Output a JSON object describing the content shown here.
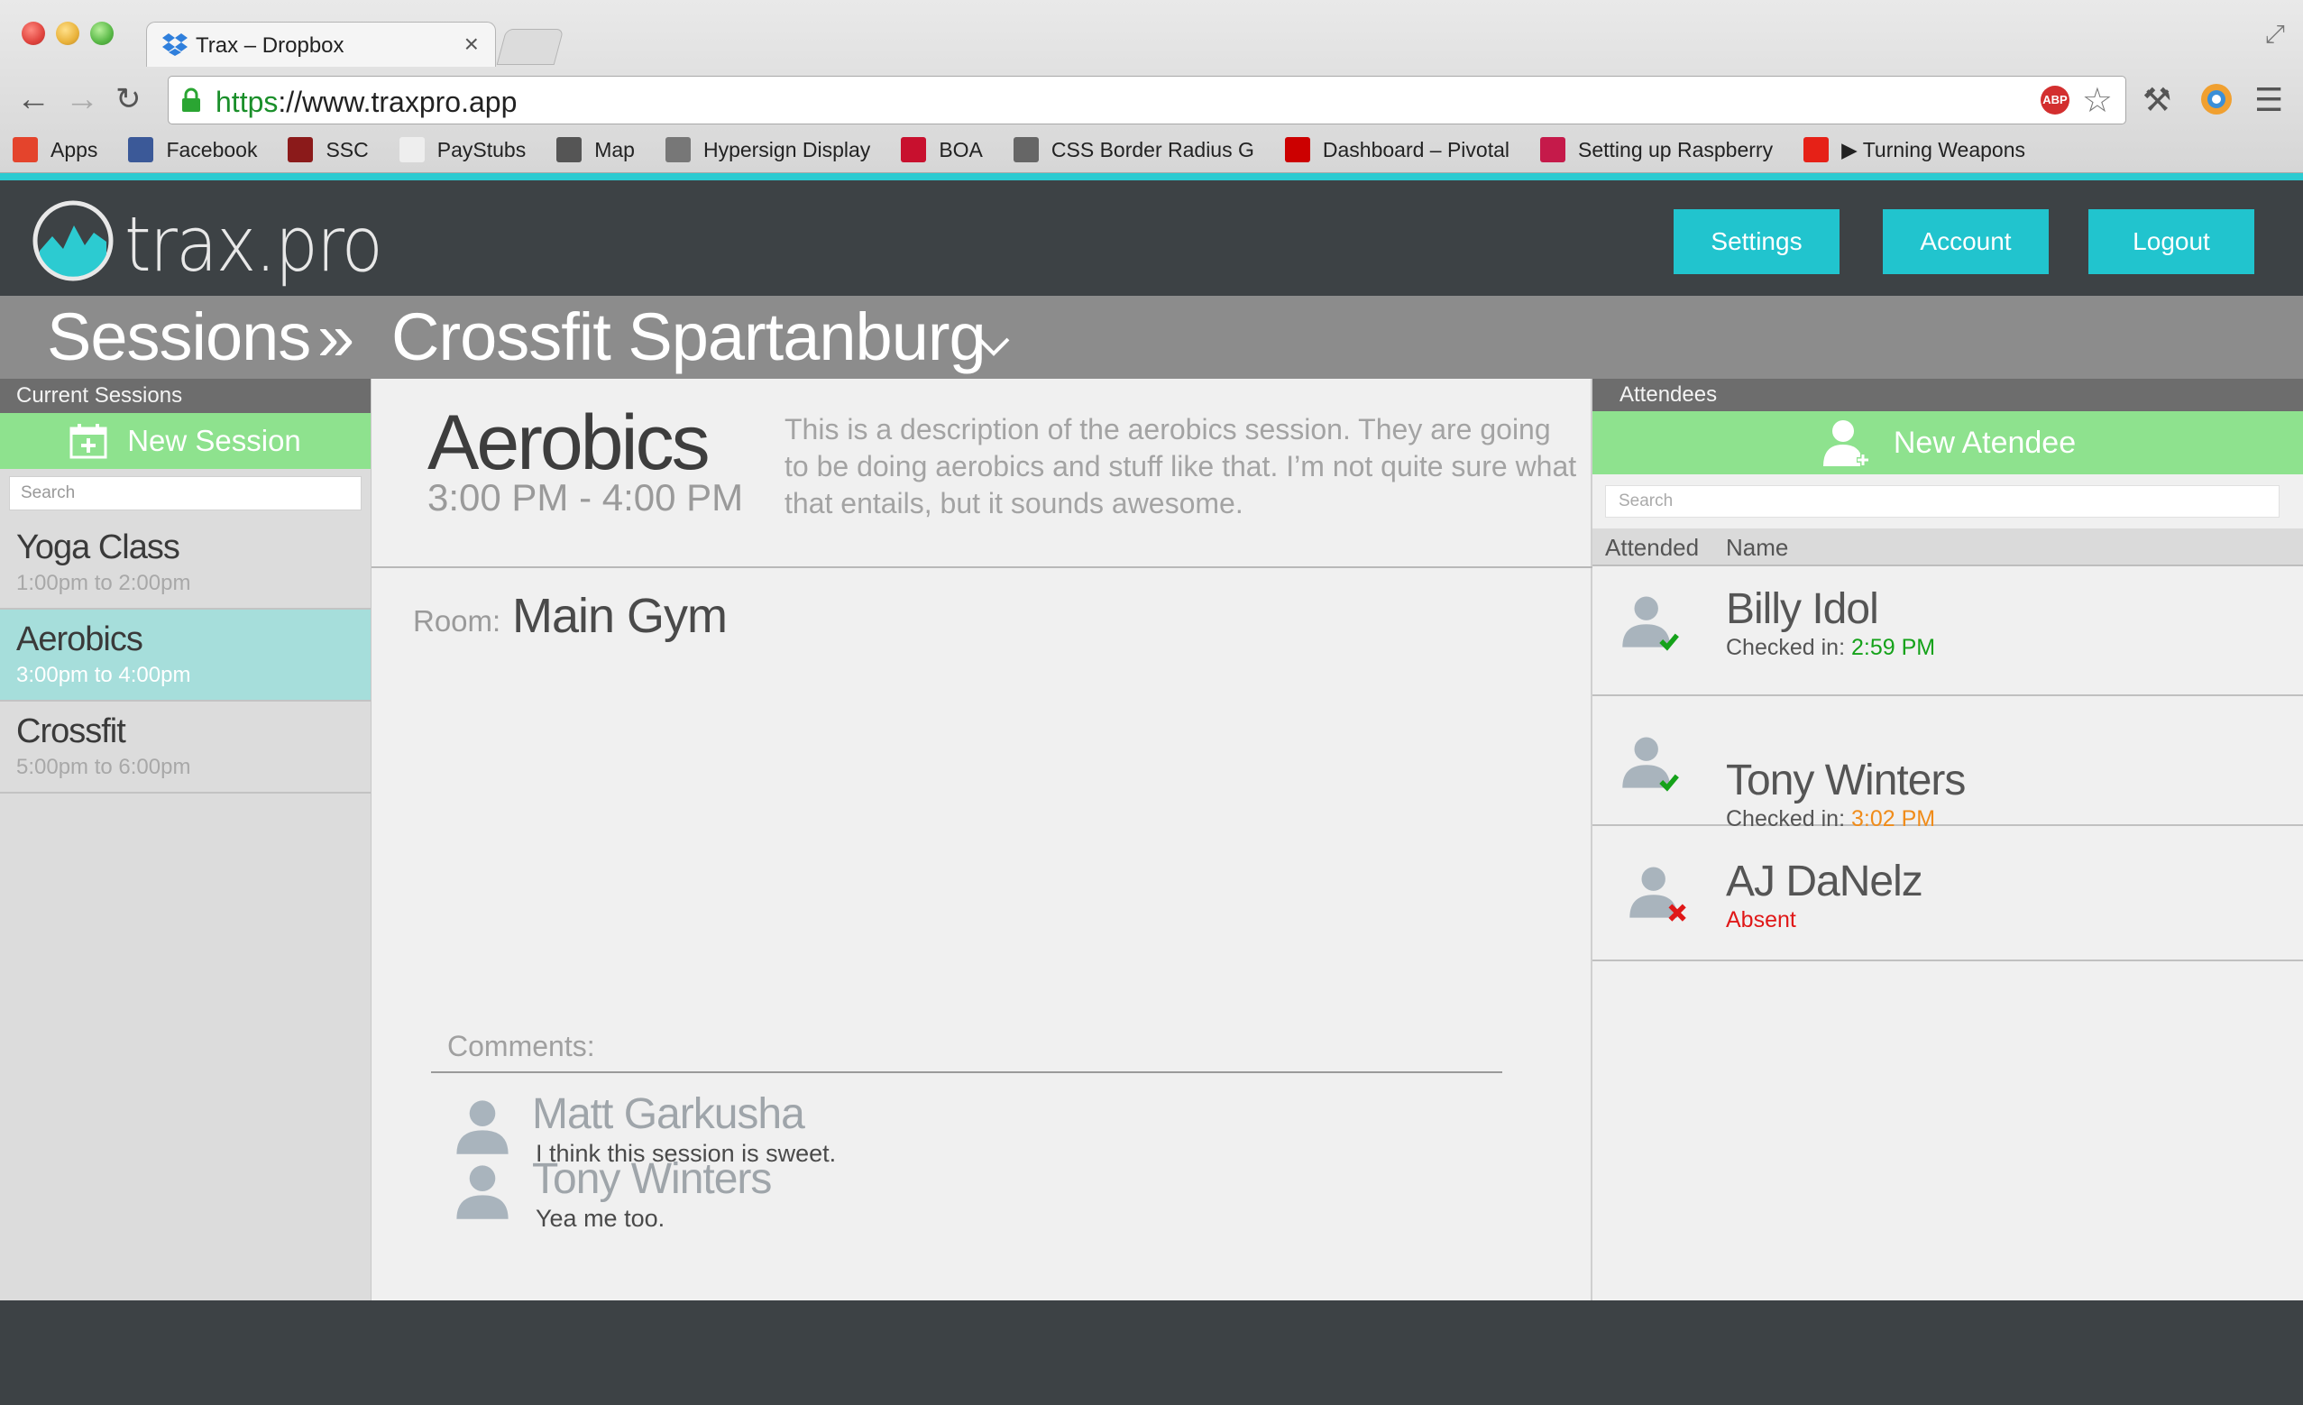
{
  "browser": {
    "tab_title": "Trax – Dropbox",
    "tab_close": "×",
    "url_scheme": "https",
    "url_rest": "://www.traxpro.app",
    "abp_label": "ABP",
    "bookmarks": [
      {
        "label": "Apps",
        "icon": "apps-grid-icon",
        "color": "#e4442c"
      },
      {
        "label": "Facebook",
        "icon": "facebook-icon",
        "color": "#3b5998"
      },
      {
        "label": "SSC",
        "icon": "ssc-icon",
        "color": "#8b1a1a"
      },
      {
        "label": "PayStubs",
        "icon": "document-icon",
        "color": "#eeeeee"
      },
      {
        "label": "Map",
        "icon": "cube-icon",
        "color": "#555555"
      },
      {
        "label": "Hypersign Display",
        "icon": "stack-icon",
        "color": "#777777"
      },
      {
        "label": "BOA",
        "icon": "boa-icon",
        "color": "#c8102e"
      },
      {
        "label": "CSS Border Radius G",
        "icon": "dot-icon",
        "color": "#666666"
      },
      {
        "label": "Dashboard – Pivotal",
        "icon": "pivotal-icon",
        "color": "#cc0000"
      },
      {
        "label": "Setting up Raspberry",
        "icon": "raspberry-icon",
        "color": "#c51a4a"
      },
      {
        "label": "▶ Turning Weapons",
        "icon": "youtube-icon",
        "color": "#e62117"
      }
    ]
  },
  "app": {
    "logo_text": "trax.pro",
    "nav": {
      "settings": "Settings",
      "account": "Account",
      "logout": "Logout"
    },
    "breadcrumb": {
      "root": "Sessions",
      "separator": "»",
      "current": "Crossfit Spartanburg"
    },
    "accent_color": "#2ccbd1",
    "green_color": "#8ee28e"
  },
  "sidebar": {
    "heading": "Current Sessions",
    "new_session": "New Session",
    "search_placeholder": "Search",
    "sessions": [
      {
        "name": "Yoga Class",
        "time": "1:00pm to 2:00pm",
        "active": false
      },
      {
        "name": "Aerobics",
        "time": "3:00pm to 4:00pm",
        "active": true
      },
      {
        "name": "Crossfit",
        "time": "5:00pm to 6:00pm",
        "active": false
      }
    ]
  },
  "session": {
    "title": "Aerobics",
    "time": "3:00 PM - 4:00 PM",
    "description": "This is a description of the aerobics session. They are going to be doing aerobics and stuff like that. I’m not quite sure what that entails, but it sounds awesome.",
    "room_label": "Room:",
    "room": "Main Gym",
    "comments_label": "Comments:",
    "comments": [
      {
        "name": "Matt Garkusha",
        "text": "I think this session is sweet."
      },
      {
        "name": "Tony Winters",
        "text": "Yea me too."
      }
    ]
  },
  "attendees": {
    "heading": "Attendees",
    "new_attendee": "New Atendee",
    "search_placeholder": "Search",
    "col_attended": "Attended",
    "col_name": "Name",
    "list": [
      {
        "name": "Billy Idol",
        "status_label": "Checked in:",
        "status_value": "2:59 PM",
        "state": "on-time"
      },
      {
        "name": "Tony Winters",
        "status_label": "Checked in:",
        "status_value": "3:02 PM",
        "state": "late"
      },
      {
        "name": "AJ DaNelz",
        "status_label": "",
        "status_value": "Absent",
        "state": "absent"
      }
    ]
  }
}
